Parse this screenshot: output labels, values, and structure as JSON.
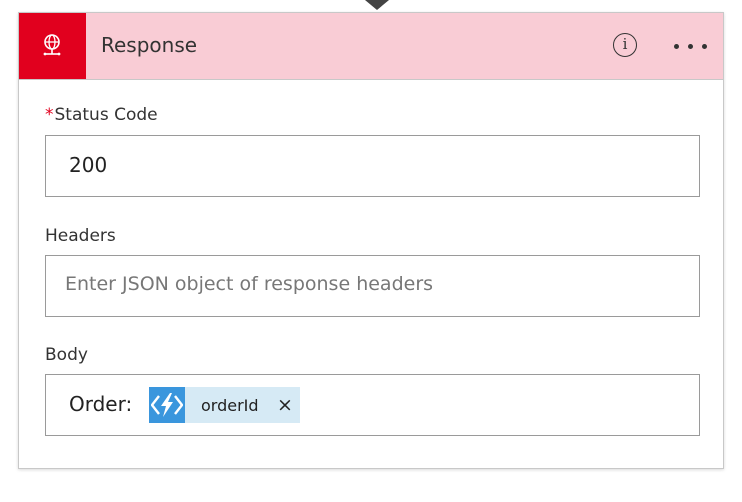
{
  "action": {
    "title": "Response",
    "icon": "globe-request-icon",
    "info_icon": "info-icon",
    "info_glyph": "i",
    "more_icon": "more-ellipsis-icon",
    "header_color": "#f9ccd5",
    "icon_box_color": "#e1001e"
  },
  "fields": {
    "status_code": {
      "required_mark": "*",
      "label": "Status Code",
      "value": "200"
    },
    "headers": {
      "label": "Headers",
      "placeholder": "Enter JSON object of response headers"
    },
    "body": {
      "label": "Body",
      "prefix": "Order:",
      "token": {
        "icon": "azure-function-icon",
        "label": "orderId",
        "remove_glyph": "×",
        "color": "#3a96dd"
      }
    }
  }
}
